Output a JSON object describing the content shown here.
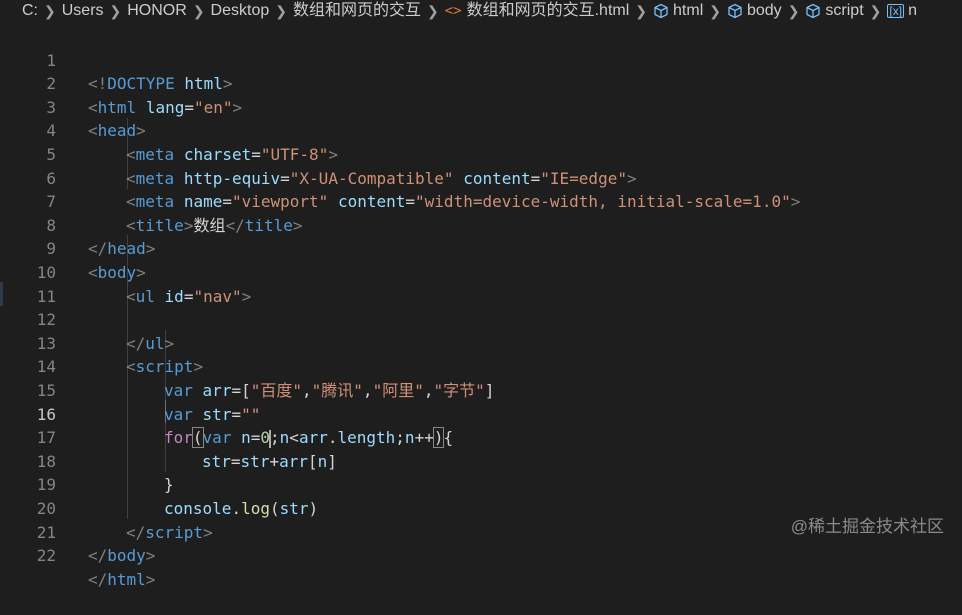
{
  "breadcrumb": {
    "items": [
      "C:",
      "Users",
      "HONOR",
      "Desktop",
      "数组和网页的交互",
      "数组和网页的交互.html",
      "html",
      "body",
      "script",
      "n"
    ]
  },
  "editor": {
    "active_line": 16,
    "line_numbers": [
      "1",
      "2",
      "3",
      "4",
      "5",
      "6",
      "7",
      "8",
      "9",
      "10",
      "11",
      "12",
      "13",
      "14",
      "15",
      "16",
      "17",
      "18",
      "19",
      "20",
      "21",
      "22"
    ],
    "lines": {
      "l1": [
        "<!",
        "DOCTYPE",
        " ",
        "html",
        ">"
      ],
      "l2": [
        "<",
        "html",
        " ",
        "lang",
        "=",
        "\"en\"",
        ">"
      ],
      "l3": [
        "<",
        "head",
        ">"
      ],
      "l4": [
        "<",
        "meta",
        " ",
        "charset",
        "=",
        "\"UTF-8\"",
        ">"
      ],
      "l5": [
        "<",
        "meta",
        " ",
        "http-equiv",
        "=",
        "\"X-UA-Compatible\"",
        " ",
        "content",
        "=",
        "\"IE=edge\"",
        ">"
      ],
      "l6": [
        "<",
        "meta",
        " ",
        "name",
        "=",
        "\"viewport\"",
        " ",
        "content",
        "=",
        "\"width=device-width, initial-scale=1.0\"",
        ">"
      ],
      "l7": [
        "<",
        "title",
        ">",
        "数组",
        "</",
        "title",
        ">"
      ],
      "l8": [
        "</",
        "head",
        ">"
      ],
      "l9": [
        "<",
        "body",
        ">"
      ],
      "l10": [
        "<",
        "ul",
        " ",
        "id",
        "=",
        "\"nav\"",
        ">"
      ],
      "l12": [
        "</",
        "ul",
        ">"
      ],
      "l13": [
        "<",
        "script",
        ">"
      ],
      "l14": [
        "var",
        " ",
        "arr",
        "=[",
        "\"百度\"",
        ",",
        "\"腾讯\"",
        ",",
        "\"阿里\"",
        ",",
        "\"字节\"",
        "]"
      ],
      "l15": [
        "var",
        " ",
        "str",
        "=",
        "\"\""
      ],
      "l16": [
        "for",
        "(",
        "var",
        " ",
        "n",
        "=",
        "0",
        ";",
        "n",
        "<",
        "arr",
        ".",
        "length",
        ";",
        "n",
        "++",
        ")",
        "{"
      ],
      "l17": [
        "str",
        "=",
        "str",
        "+",
        "arr",
        "[",
        "n",
        "]"
      ],
      "l18": [
        "}"
      ],
      "l19": [
        "console",
        ".",
        "log",
        "(",
        "str",
        ")"
      ],
      "l20": [
        "</",
        "script",
        ">"
      ],
      "l21": [
        "</",
        "body",
        ">"
      ],
      "l22": [
        "</",
        "html",
        ">"
      ]
    }
  },
  "watermark": "@稀土掘金技术社区",
  "colors": {
    "background": "#1e1e1e",
    "tag": "#569cd6",
    "attribute": "#9cdcfe",
    "string": "#ce9178",
    "control": "#c586c0",
    "number": "#b5cea8",
    "function": "#dcdcaa"
  }
}
